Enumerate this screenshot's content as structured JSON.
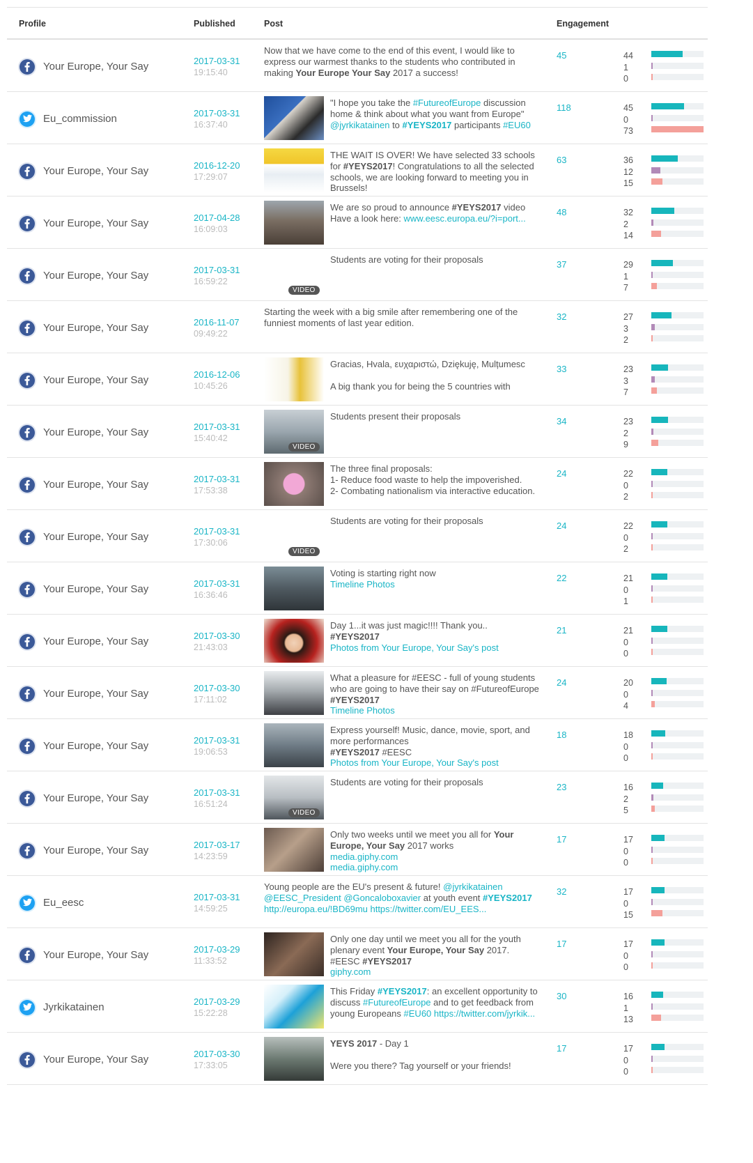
{
  "headers": {
    "profile": "Profile",
    "published": "Published",
    "post": "Post",
    "engagement": "Engagement"
  },
  "rows": [
    {
      "net": "fb",
      "profile": "Your Europe, Your Say",
      "date": "2017-03-31",
      "time": "19:15:40",
      "thumb": "none",
      "post_html": "Now that we have come to the end of this event, I would like to express our warmest thanks to the students who contributed in making <b>Your Europe Your Say</b> 2017 a success!",
      "engagement": "45",
      "stats": [
        "44",
        "1",
        "0"
      ],
      "fractions": [
        0.6,
        0.03,
        0.01
      ]
    },
    {
      "net": "tw",
      "profile": "Eu_commission",
      "date": "2017-03-31",
      "time": "16:37:40",
      "thumb": "person",
      "post_html": "\"I hope you take the <span class=\"lk\">#FutureofEurope</span> discussion home &amp; think about what you want from Europe\" <span class=\"lk\">@jyrkikatainen</span> to <b class=\"lk\">#YEYS2017</b> participants <span class=\"lk\">#EU60</span>",
      "engagement": "118",
      "stats": [
        "45",
        "0",
        "73"
      ],
      "fractions": [
        0.62,
        0.01,
        1.0
      ]
    },
    {
      "net": "fb",
      "profile": "Your Europe, Your Say",
      "date": "2016-12-20",
      "time": "17:29:07",
      "thumb": "list",
      "post_html": "THE WAIT IS OVER! We have selected 33 schools for <b>#YEYS2017</b>! Congratulations to all the selected schools, we are looking forward to meeting you in Brussels!",
      "engagement": "63",
      "stats": [
        "36",
        "12",
        "15"
      ],
      "fractions": [
        0.5,
        0.17,
        0.21
      ]
    },
    {
      "net": "fb",
      "profile": "Your Europe, Your Say",
      "date": "2017-04-28",
      "time": "16:09:03",
      "thumb": "crowd",
      "post_html": "We are so proud to announce <b>#YEYS2017</b> video<br>Have a look here: <span class=\"lk\">www.eesc.europa.eu/?i=port...</span>",
      "engagement": "48",
      "stats": [
        "32",
        "2",
        "14"
      ],
      "fractions": [
        0.44,
        0.04,
        0.19
      ]
    },
    {
      "net": "fb",
      "profile": "Your Europe, Your Say",
      "date": "2017-03-31",
      "time": "16:59:22",
      "thumb": "none",
      "video": true,
      "post_html": "Students are voting for their proposals",
      "engagement": "37",
      "stats": [
        "29",
        "1",
        "7"
      ],
      "fractions": [
        0.41,
        0.03,
        0.1
      ]
    },
    {
      "net": "fb",
      "profile": "Your Europe, Your Say",
      "date": "2016-11-07",
      "time": "09:49:22",
      "thumb": "none",
      "post_html": "Starting the week with a big smile after remembering one of the funniest moments of last year edition.",
      "engagement": "32",
      "stats": [
        "27",
        "3",
        "2"
      ],
      "fractions": [
        0.38,
        0.06,
        0.03
      ]
    },
    {
      "net": "fb",
      "profile": "Your Europe, Your Say",
      "date": "2016-12-06",
      "time": "10:45:26",
      "thumb": "chart",
      "post_html": "Gracias, Hvala, ευχαριστώ, Dziękuję, Mulțumesc<br><br>A big thank you for being the 5 countries with",
      "engagement": "33",
      "stats": [
        "23",
        "3",
        "7"
      ],
      "fractions": [
        0.32,
        0.06,
        0.1
      ]
    },
    {
      "net": "fb",
      "profile": "Your Europe, Your Say",
      "date": "2017-03-31",
      "time": "15:40:42",
      "thumb": "hall",
      "video": true,
      "post_html": "Students present their proposals",
      "engagement": "34",
      "stats": [
        "23",
        "2",
        "9"
      ],
      "fractions": [
        0.32,
        0.04,
        0.13
      ]
    },
    {
      "net": "fb",
      "profile": "Your Europe, Your Say",
      "date": "2017-03-31",
      "time": "17:53:38",
      "thumb": "pink",
      "post_html": "The three final proposals:<br>1- Reduce food waste to help the impoverished.<br>2- Combating nationalism via interactive education.",
      "engagement": "24",
      "stats": [
        "22",
        "0",
        "2"
      ],
      "fractions": [
        0.31,
        0.01,
        0.03
      ]
    },
    {
      "net": "fb",
      "profile": "Your Europe, Your Say",
      "date": "2017-03-31",
      "time": "17:30:06",
      "thumb": "none",
      "video": true,
      "post_html": "Students are voting for their proposals",
      "engagement": "24",
      "stats": [
        "22",
        "0",
        "2"
      ],
      "fractions": [
        0.31,
        0.01,
        0.03
      ]
    },
    {
      "net": "fb",
      "profile": "Your Europe, Your Say",
      "date": "2017-03-31",
      "time": "16:36:46",
      "thumb": "audience",
      "post_html": "Voting is starting right now<br><span class=\"lk\">Timeline Photos</span>",
      "engagement": "22",
      "stats": [
        "21",
        "0",
        "1"
      ],
      "fractions": [
        0.3,
        0.01,
        0.02
      ]
    },
    {
      "net": "fb",
      "profile": "Your Europe, Your Say",
      "date": "2017-03-30",
      "time": "21:43:03",
      "thumb": "woman",
      "post_html": "Day 1...it was just magic!!!! Thank you..<br><b>#YEYS2017</b><br><span class=\"lk\">Photos from Your Europe, Your Say's post</span>",
      "engagement": "21",
      "stats": [
        "21",
        "0",
        "0"
      ],
      "fractions": [
        0.3,
        0.01,
        0.01
      ]
    },
    {
      "net": "fb",
      "profile": "Your Europe, Your Say",
      "date": "2017-03-30",
      "time": "17:11:02",
      "thumb": "lobby",
      "post_html": "What a pleasure for #EESC - full of young students who are going to have their say on #FutureofEurope <b>#YEYS2017</b><br><span class=\"lk\">Timeline Photos</span>",
      "engagement": "24",
      "stats": [
        "20",
        "0",
        "4"
      ],
      "fractions": [
        0.29,
        0.01,
        0.06
      ]
    },
    {
      "net": "fb",
      "profile": "Your Europe, Your Say",
      "date": "2017-03-31",
      "time": "19:06:53",
      "thumb": "stage",
      "post_html": "Express yourself! Music, dance, movie, sport, and more performances<br><b>#YEYS2017</b> #EESC<br><span class=\"lk\">Photos from Your Europe, Your Say's post</span>",
      "engagement": "18",
      "stats": [
        "18",
        "0",
        "0"
      ],
      "fractions": [
        0.26,
        0.01,
        0.01
      ]
    },
    {
      "net": "fb",
      "profile": "Your Europe, Your Say",
      "date": "2017-03-31",
      "time": "16:51:24",
      "thumb": "room",
      "video": true,
      "post_html": "Students are voting for their proposals",
      "engagement": "23",
      "stats": [
        "16",
        "2",
        "5"
      ],
      "fractions": [
        0.23,
        0.04,
        0.07
      ]
    },
    {
      "net": "fb",
      "profile": "Your Europe, Your Say",
      "date": "2017-03-17",
      "time": "14:23:59",
      "thumb": "party",
      "post_html": "Only two weeks until we meet you all for <b>Your Europe, Your Say</b> 2017 works<br><span class=\"lk\">media.giphy.com</span><br><span class=\"lk\">media.giphy.com</span>",
      "engagement": "17",
      "stats": [
        "17",
        "0",
        "0"
      ],
      "fractions": [
        0.25,
        0.01,
        0.01
      ]
    },
    {
      "net": "tw",
      "profile": "Eu_eesc",
      "date": "2017-03-31",
      "time": "14:59:25",
      "thumb": "none",
      "post_html": "Young people are the EU's present &amp; future! <span class=\"lk\">@jyrkikatainen @EESC_President @Goncaloboxavier</span> at youth event <b class=\"lk\">#YEYS2017</b> <span class=\"lk\">http://europa.eu/!BD69mu https://twitter.com/EU_EES...</span>",
      "engagement": "32",
      "stats": [
        "17",
        "0",
        "15"
      ],
      "fractions": [
        0.25,
        0.01,
        0.21
      ]
    },
    {
      "net": "fb",
      "profile": "Your Europe, Your Say",
      "date": "2017-03-29",
      "time": "11:33:52",
      "thumb": "man",
      "post_html": "Only one day until we meet you all for the youth plenary event <b>Your Europe, Your Say</b> 2017.<br>#EESC <b>#YEYS2017</b><br><span class=\"lk\">giphy.com</span>",
      "engagement": "17",
      "stats": [
        "17",
        "0",
        "0"
      ],
      "fractions": [
        0.25,
        0.01,
        0.01
      ]
    },
    {
      "net": "tw",
      "profile": "Jyrkikatainen",
      "date": "2017-03-29",
      "time": "15:22:28",
      "thumb": "logo",
      "post_html": "This Friday <b class=\"lk\">#YEYS2017</b>: an excellent opportunity to discuss <span class=\"lk\">#FutureofEurope</span> and to get feedback from young Europeans <span class=\"lk\">#EU60</span> <span class=\"lk\">https://twitter.com/jyrkik...</span>",
      "engagement": "30",
      "stats": [
        "16",
        "1",
        "13"
      ],
      "fractions": [
        0.23,
        0.03,
        0.19
      ]
    },
    {
      "net": "fb",
      "profile": "Your Europe, Your Say",
      "date": "2017-03-30",
      "time": "17:33:05",
      "thumb": "hall2",
      "post_html": "<b>YEYS 2017</b> - Day 1<br><br>Were you there? Tag yourself or your friends!",
      "engagement": "17",
      "stats": [
        "17",
        "0",
        "0"
      ],
      "fractions": [
        0.25,
        0.01,
        0.01
      ]
    }
  ]
}
